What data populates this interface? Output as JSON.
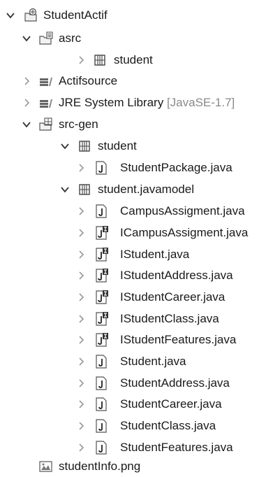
{
  "tree": {
    "project": {
      "label": "StudentActif",
      "icon": "project-icon",
      "expanded": true
    },
    "asrc": {
      "label": "asrc",
      "icon": "source-folder-icon",
      "expanded": true,
      "children": [
        {
          "label": "student",
          "icon": "package-icon",
          "expanded": false
        }
      ]
    },
    "actifsource": {
      "label": "Actifsource",
      "icon": "library-icon",
      "expanded": false
    },
    "jre": {
      "label": "JRE System Library",
      "decoration": "[JavaSE-1.7]",
      "icon": "library-icon",
      "expanded": false
    },
    "srcgen": {
      "label": "src-gen",
      "icon": "source-folder-icon",
      "expanded": true,
      "packages": [
        {
          "label": "student",
          "icon": "package-icon",
          "expanded": true,
          "files": [
            {
              "label": "StudentPackage.java",
              "icon": "java-file-icon"
            }
          ]
        },
        {
          "label": "student.javamodel",
          "icon": "package-icon",
          "expanded": true,
          "files": [
            {
              "label": "CampusAssigment.java",
              "icon": "java-file-icon"
            },
            {
              "label": "ICampusAssigment.java",
              "icon": "java-interface-file-icon"
            },
            {
              "label": "IStudent.java",
              "icon": "java-interface-file-icon"
            },
            {
              "label": "IStudentAddress.java",
              "icon": "java-interface-file-icon"
            },
            {
              "label": "IStudentCareer.java",
              "icon": "java-interface-file-icon"
            },
            {
              "label": "IStudentClass.java",
              "icon": "java-interface-file-icon"
            },
            {
              "label": "IStudentFeatures.java",
              "icon": "java-interface-file-icon"
            },
            {
              "label": "Student.java",
              "icon": "java-file-icon"
            },
            {
              "label": "StudentAddress.java",
              "icon": "java-file-icon"
            },
            {
              "label": "StudentCareer.java",
              "icon": "java-file-icon"
            },
            {
              "label": "StudentClass.java",
              "icon": "java-file-icon"
            },
            {
              "label": "StudentFeatures.java",
              "icon": "java-file-icon"
            }
          ]
        }
      ]
    },
    "image_file": {
      "label": "studentInfo.png",
      "icon": "image-file-icon"
    }
  }
}
